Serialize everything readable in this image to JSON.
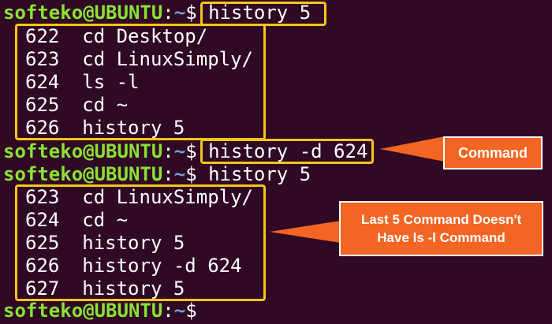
{
  "prompt": {
    "user_host": "softeko@UBUNTU",
    "separator": ":",
    "path": "~",
    "dollar": "$"
  },
  "lines": [
    {
      "type": "prompt",
      "command": " history 5"
    },
    {
      "type": "output",
      "text": "622  cd Desktop/"
    },
    {
      "type": "output",
      "text": "623  cd LinuxSimply/"
    },
    {
      "type": "output",
      "text": "624  ls -l"
    },
    {
      "type": "output",
      "text": "625  cd ~"
    },
    {
      "type": "output",
      "text": "626  history 5"
    },
    {
      "type": "prompt",
      "command": " history -d 624"
    },
    {
      "type": "prompt",
      "command": " history 5"
    },
    {
      "type": "output",
      "text": "623  cd LinuxSimply/"
    },
    {
      "type": "output",
      "text": "624  cd ~"
    },
    {
      "type": "output",
      "text": "625  history 5"
    },
    {
      "type": "output",
      "text": "626  history -d 624"
    },
    {
      "type": "output",
      "text": "627  history 5"
    },
    {
      "type": "prompt",
      "command": ""
    }
  ],
  "callouts": {
    "command": "Command",
    "last5_line1": "Last 5 Command Doesn't",
    "last5_line2": "Have ls -l Command"
  },
  "colors": {
    "background": "#300a24",
    "user": "#8ae234",
    "path": "#729fcf",
    "highlight": "#f5c518",
    "callout": "#f26522"
  }
}
